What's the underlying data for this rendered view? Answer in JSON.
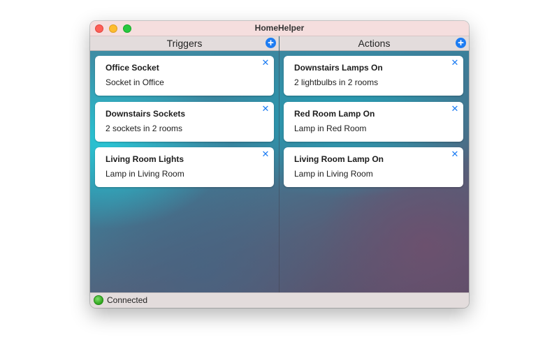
{
  "window": {
    "title": "HomeHelper"
  },
  "triggers": {
    "header": "Triggers",
    "add_icon": "+",
    "items": [
      {
        "title": "Office Socket",
        "subtitle": "Socket in Office"
      },
      {
        "title": "Downstairs Sockets",
        "subtitle": "2 sockets in 2 rooms"
      },
      {
        "title": "Living Room Lights",
        "subtitle": "Lamp in Living Room"
      }
    ]
  },
  "actions": {
    "header": "Actions",
    "add_icon": "+",
    "items": [
      {
        "title": "Downstairs Lamps On",
        "subtitle": "2 lightbulbs in 2 rooms"
      },
      {
        "title": "Red Room Lamp On",
        "subtitle": "Lamp in Red Room"
      },
      {
        "title": "Living Room Lamp On",
        "subtitle": "Lamp in Living Room"
      }
    ]
  },
  "close_icon": "✕",
  "status": {
    "text": "Connected",
    "color": "#2fa51c"
  },
  "colors": {
    "accent": "#1c7cf3"
  }
}
